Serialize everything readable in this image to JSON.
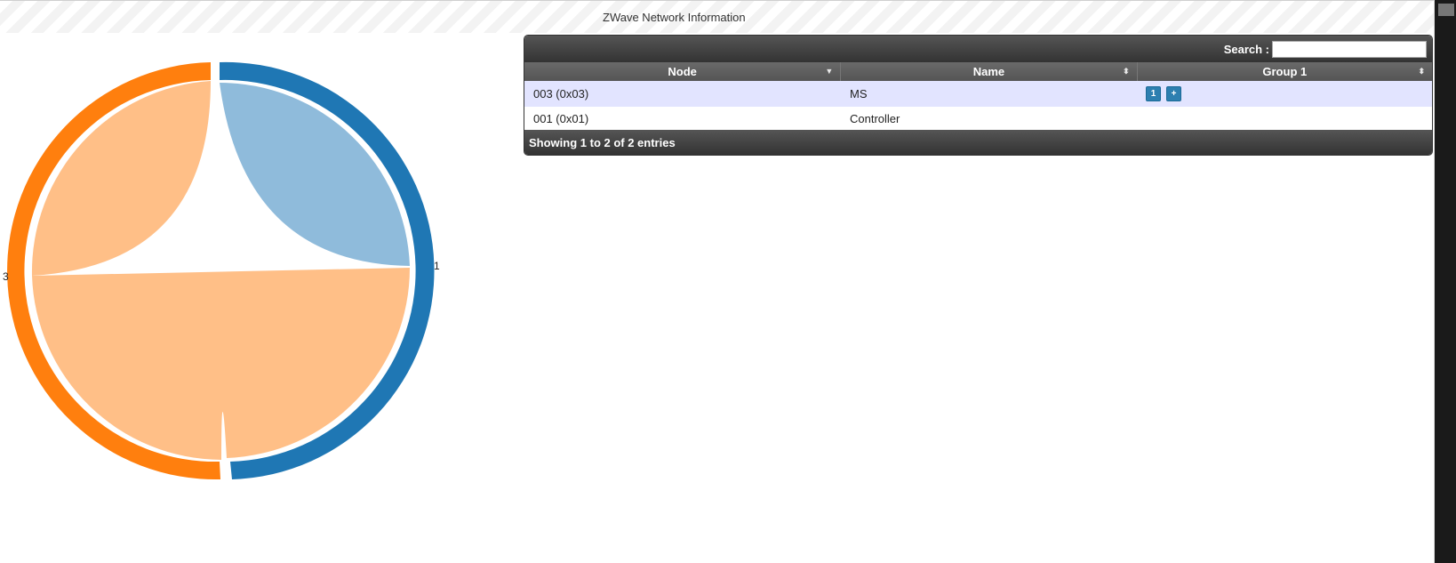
{
  "page": {
    "title": "ZWave Network Information"
  },
  "chord": {
    "labels": [
      "1",
      "3"
    ],
    "colors": {
      "node1_arc": "#1f77b4",
      "node1_chord": "#8fbbdb",
      "node3_arc": "#ff7f0e",
      "node3_chord": "#ffbf87"
    }
  },
  "table": {
    "search_label": "Search :",
    "search_value": "",
    "columns": [
      {
        "label": "Node",
        "sort_icon": "sort-desc-icon"
      },
      {
        "label": "Name",
        "sort_icon": "sort-both-icon"
      },
      {
        "label": "Group 1",
        "sort_icon": "sort-both-icon"
      }
    ],
    "rows": [
      {
        "node": "003 (0x03)",
        "name": "MS",
        "group_buttons": [
          "1",
          "+"
        ]
      },
      {
        "node": "001 (0x01)",
        "name": "Controller",
        "group_buttons": []
      }
    ],
    "footer": "Showing 1 to 2 of 2 entries"
  }
}
